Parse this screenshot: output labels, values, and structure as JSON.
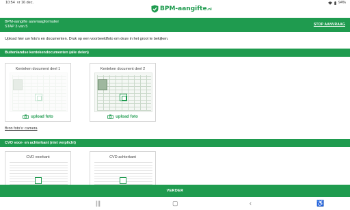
{
  "status": {
    "time": "10:54",
    "date": "vr 16 dec.",
    "battery": "94%"
  },
  "logo": {
    "text": "BPM-aangifte",
    "suffix": ".nl"
  },
  "header": {
    "line1": "BPM-aangifte aanvraagformulier",
    "line2": "STAP 3 van 5",
    "stop_label": "STOP AANVRAAG"
  },
  "intro": "Upload hier uw foto's en documenten. Druk op een voorbeeldfoto om deze in het groot te bekijken.",
  "section1": {
    "title": "Buitenlandse kentekendocumenten (alle delen)",
    "cards": [
      {
        "title": "Kenteken document deel 1",
        "upload_label": "upload foto"
      },
      {
        "title": "Kenteken document deel 2",
        "upload_label": "upload foto"
      }
    ]
  },
  "bron_link": "Bron foto's: camera",
  "section2": {
    "title": "CVO voor- en achterkant (niet verplicht)",
    "cards": [
      {
        "title": "CVD voorkant"
      },
      {
        "title": "CVD achterkant"
      }
    ]
  },
  "next_label": "VERDER",
  "colors": {
    "brand": "#1f9b4f"
  }
}
